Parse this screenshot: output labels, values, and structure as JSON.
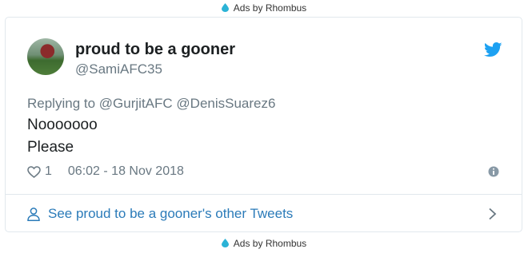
{
  "ads": {
    "label": "Ads by Rhombus",
    "icon": "droplet-icon"
  },
  "tweet": {
    "display_name": "proud to be a gooner",
    "handle": "@SamiAFC35",
    "replying_prefix": "Replying to",
    "reply_mentions": [
      "@GurjitAFC",
      "@DenisSuarez6"
    ],
    "text_lines": [
      "Nooooooo",
      "Please"
    ],
    "likes": "1",
    "timestamp": "06:02 - 18 Nov 2018",
    "see_other": "See proud to be a gooner's other Tweets"
  },
  "colors": {
    "twitter_blue": "#1da1f2",
    "link": "#2b7bb9",
    "muted": "#697882",
    "border": "#e1e8ed"
  }
}
